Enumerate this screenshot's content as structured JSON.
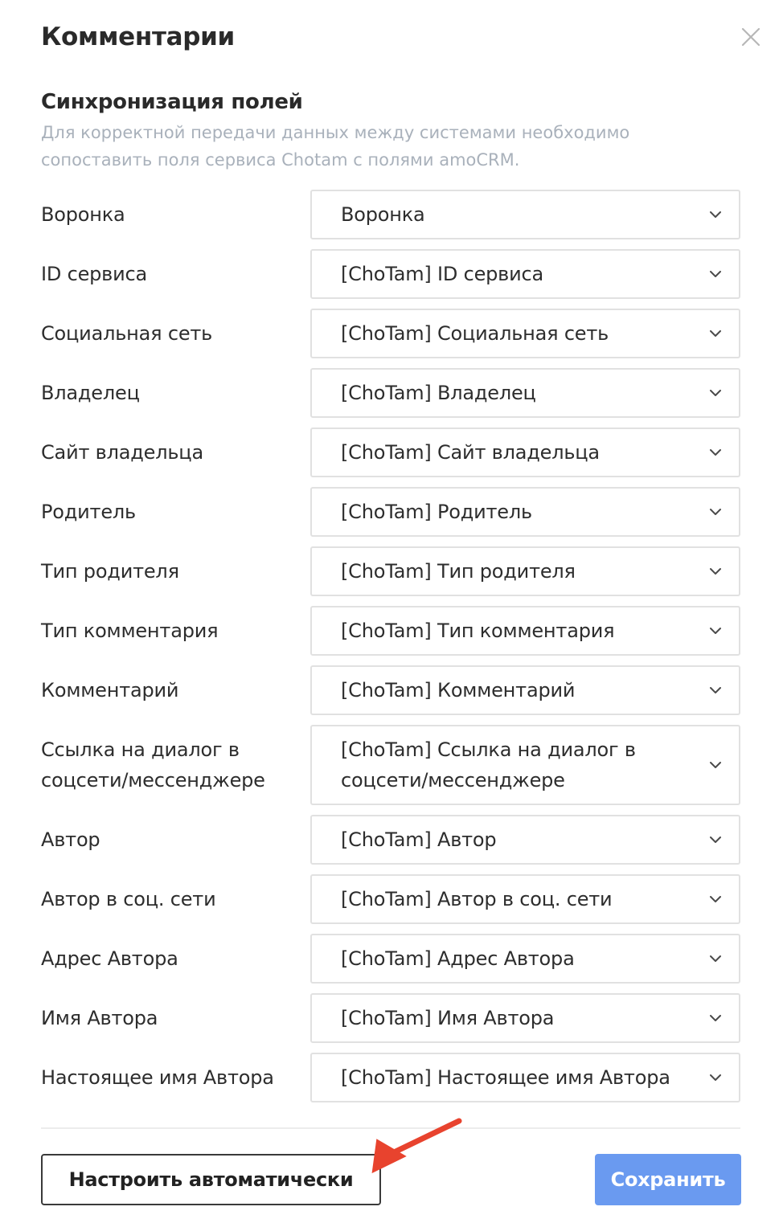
{
  "header": {
    "title": "Комментарии",
    "close_icon": "close-icon"
  },
  "section": {
    "title": "Синхронизация полей",
    "description": "Для корректной передачи данных между системами необходимо сопоставить поля сервиса Chotam с полями amoCRM."
  },
  "fields": [
    {
      "label": "Воронка",
      "value": "Воронка"
    },
    {
      "label": "ID сервиса",
      "value": "[ChoTam] ID сервиса"
    },
    {
      "label": "Социальная сеть",
      "value": "[ChoTam] Социальная сеть"
    },
    {
      "label": "Владелец",
      "value": "[ChoTam] Владелец"
    },
    {
      "label": "Сайт владельца",
      "value": "[ChoTam] Сайт владельца"
    },
    {
      "label": "Родитель",
      "value": "[ChoTam] Родитель"
    },
    {
      "label": "Тип родителя",
      "value": "[ChoTam] Тип родителя"
    },
    {
      "label": "Тип комментария",
      "value": "[ChoTam] Тип комментария"
    },
    {
      "label": "Комментарий",
      "value": "[ChoTam] Комментарий"
    },
    {
      "label": "Ссылка на диалог в соцсети/мессенджере",
      "value": "[ChoTam] Ссылка на диалог в соцсети/мессенджере"
    },
    {
      "label": "Автор",
      "value": "[ChoTam] Автор"
    },
    {
      "label": "Автор в соц. сети",
      "value": "[ChoTam] Автор в соц. сети"
    },
    {
      "label": "Адрес Автора",
      "value": "[ChoTam] Адрес Автора"
    },
    {
      "label": "Имя Автора",
      "value": "[ChoTam] Имя Автора"
    },
    {
      "label": "Настоящее имя Автора",
      "value": "[ChoTam] Настоящее имя Автора"
    }
  ],
  "footer": {
    "auto_label": "Настроить автоматически",
    "save_label": "Сохранить"
  },
  "colors": {
    "save_button": "#6a9af0",
    "annotation_arrow": "#e8432e",
    "description_text": "#a9b1bb"
  }
}
